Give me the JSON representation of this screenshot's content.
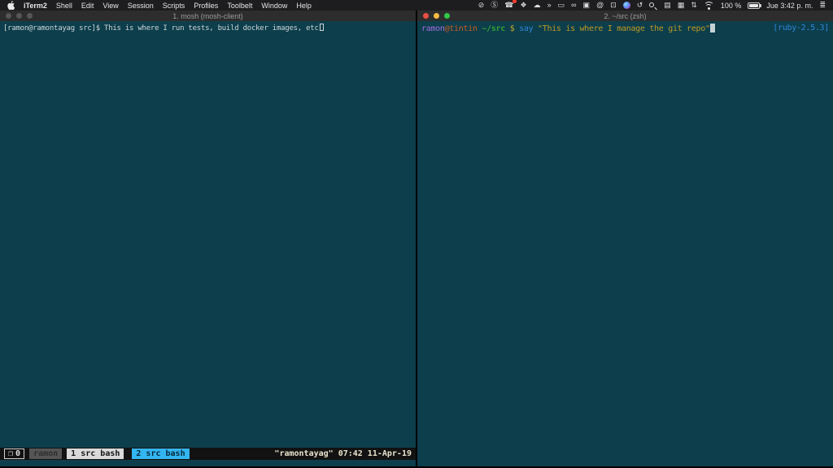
{
  "menu_bar": {
    "items": [
      "iTerm2",
      "Shell",
      "Edit",
      "View",
      "Session",
      "Scripts",
      "Profiles",
      "Toolbelt",
      "Window",
      "Help"
    ],
    "status_icons": {
      "mute": "⊘",
      "skype": "Ⓢ",
      "phone": "☎",
      "bug": "❖",
      "cloud": "☁",
      "shuttle": "»",
      "window_manager": "▭",
      "glasses": "∞",
      "screenshot": "▣",
      "at": "@",
      "display": "⊡",
      "time_machine": "↺",
      "input_menu": "▤",
      "grid": "▦",
      "updown": "⇅",
      "notification_list": "≣"
    },
    "battery_percent": "100 %",
    "clock": "Jue 3:42 p. m."
  },
  "left_window": {
    "title": "1. mosh (mosh-client)",
    "prompt": "[ramon@ramontayag src]$",
    "command": " This is where I run tests, build docker images, etc",
    "status_bar": {
      "session_icon": "❐",
      "session_index": "0",
      "host_label": "ramon",
      "windows": [
        "1 src bash",
        "2 src bash"
      ],
      "right_status": "\"ramontayag\" 07:42 11-Apr-19"
    }
  },
  "right_window": {
    "title": "2. ~/src (zsh)",
    "prompt_user": "ramon",
    "prompt_host": "@tintin",
    "prompt_path": " ~/src",
    "prompt_symbol": " $",
    "command": " say",
    "argument": " \"This is where I manage the git repo\"",
    "right_tag": "[ruby-2.5.3]"
  },
  "colors": {
    "terminal_bg": "#0d3e4c",
    "menubar_bg": "#1d1d1f",
    "titlebar_bg": "#2d2d2d",
    "prompt_user": "#9e6ee0",
    "prompt_host": "#cb5a1f",
    "prompt_path": "#33a133",
    "prompt_symbol": "#c9a727",
    "command_blue": "#2e86d9",
    "string_yellow": "#bd9a23",
    "ruby_tag": "#2e86d9",
    "left_text": "#ccd4d6",
    "tmux_bar_bg": "#121212",
    "tmux_active_bg": "#33b5f0",
    "tmux_inactive_bg": "#d9d9d9",
    "tmux_host_bg": "#555555",
    "tmux_right_text": "#ece4cf",
    "traffic_red": "#ea4f44",
    "traffic_yellow": "#fdbc40",
    "traffic_green": "#34c748",
    "traffic_inactive": "#565656"
  }
}
